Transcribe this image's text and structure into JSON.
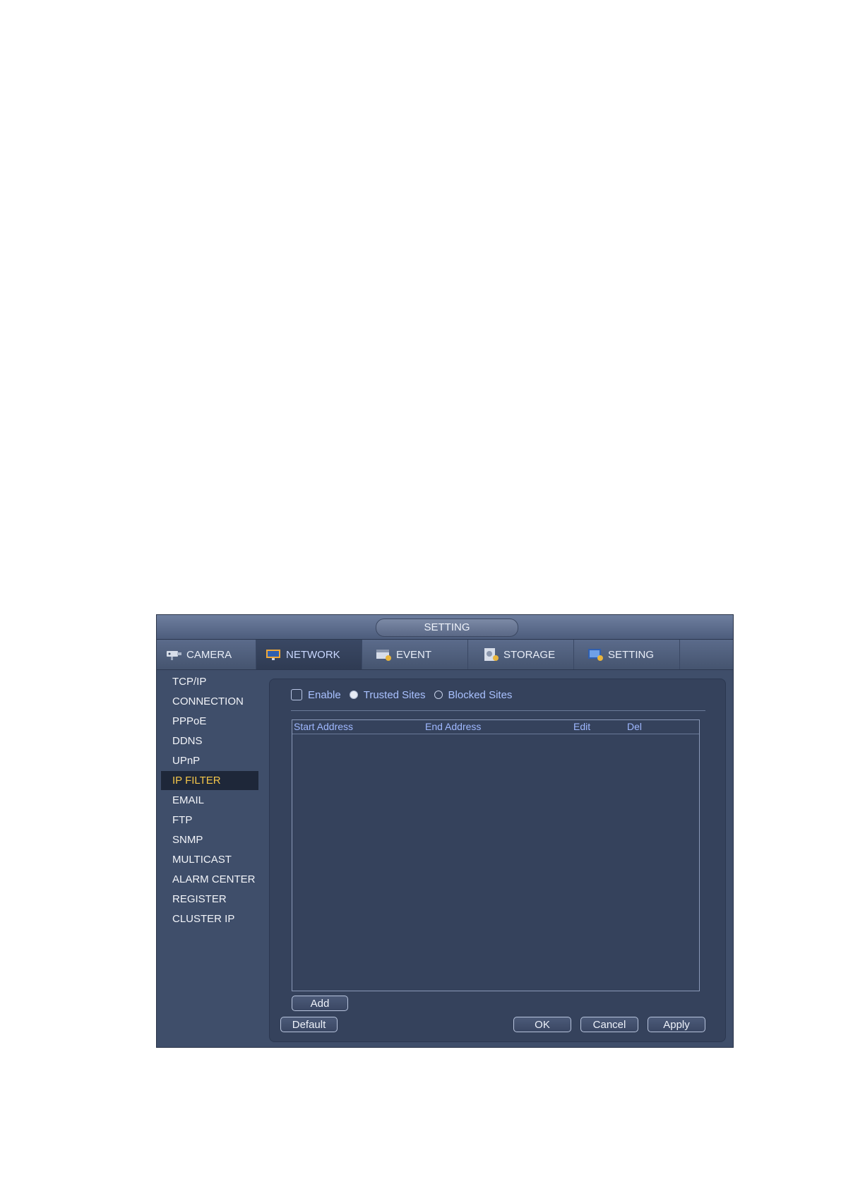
{
  "window": {
    "title": "SETTING"
  },
  "tabs": [
    {
      "label": "CAMERA",
      "icon": "camera-icon",
      "active": false
    },
    {
      "label": "NETWORK",
      "icon": "network-icon",
      "active": true
    },
    {
      "label": "EVENT",
      "icon": "event-icon",
      "active": false
    },
    {
      "label": "STORAGE",
      "icon": "storage-icon",
      "active": false
    },
    {
      "label": "SETTING",
      "icon": "setting-icon",
      "active": false
    }
  ],
  "sidebar": {
    "items": [
      {
        "label": "TCP/IP"
      },
      {
        "label": "CONNECTION"
      },
      {
        "label": "PPPoE"
      },
      {
        "label": "DDNS"
      },
      {
        "label": "UPnP"
      },
      {
        "label": "IP FILTER",
        "active": true
      },
      {
        "label": "EMAIL"
      },
      {
        "label": "FTP"
      },
      {
        "label": "SNMP"
      },
      {
        "label": "MULTICAST"
      },
      {
        "label": "ALARM CENTER"
      },
      {
        "label": "REGISTER"
      },
      {
        "label": "CLUSTER IP"
      }
    ]
  },
  "filter": {
    "enable_label": "Enable",
    "enable_checked": false,
    "trusted_label": "Trusted Sites",
    "blocked_label": "Blocked Sites",
    "selected": "Trusted Sites"
  },
  "table": {
    "columns": [
      "Start Address",
      "End Address",
      "Edit",
      "Del"
    ],
    "rows": []
  },
  "buttons": {
    "add": "Add",
    "default": "Default",
    "ok": "OK",
    "cancel": "Cancel",
    "apply": "Apply"
  },
  "colors": {
    "accent_text": "#a9c1ff",
    "active_sidebar_text": "#f4c64a",
    "panel_bg": "#35425c"
  }
}
